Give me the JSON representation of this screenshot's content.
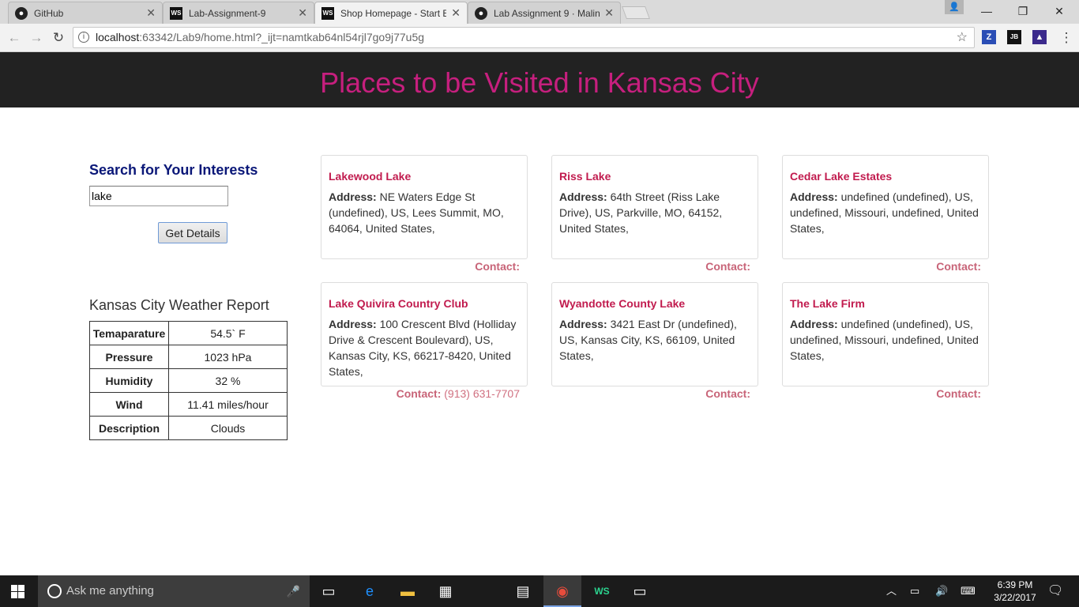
{
  "browser": {
    "tabs": [
      {
        "label": "GitHub",
        "icon": "github-icon"
      },
      {
        "label": "Lab-Assignment-9",
        "icon": "webstorm-icon"
      },
      {
        "label": "Shop Homepage - Start B",
        "icon": "webstorm-icon"
      },
      {
        "label": "Lab Assignment 9 · Malin",
        "icon": "github-icon"
      }
    ],
    "address_host": "localhost",
    "address_rest": ":63342/Lab9/home.html?_ijt=namtkab64nl54rjl7go9j77u5g"
  },
  "page": {
    "title": "Places to be Visited in Kansas City",
    "search": {
      "heading": "Search for Your Interests",
      "value": "lake",
      "button": "Get Details"
    },
    "weather": {
      "heading": "Kansas City Weather Report",
      "rows": [
        {
          "key": "Temaparature",
          "value": "54.5` F"
        },
        {
          "key": "Pressure",
          "value": "1023 hPa"
        },
        {
          "key": "Humidity",
          "value": "32 %"
        },
        {
          "key": "Wind",
          "value": "11.41 miles/hour"
        },
        {
          "key": "Description",
          "value": "Clouds"
        }
      ]
    },
    "address_label": "Address:",
    "contact_label": "Contact:",
    "places": [
      {
        "name": "Lakewood Lake",
        "address": "NE Waters Edge St (undefined), US, Lees Summit, MO, 64064, United States,",
        "contact": ""
      },
      {
        "name": "Riss Lake",
        "address": "64th Street (Riss Lake Drive), US, Parkville, MO, 64152, United States,",
        "contact": ""
      },
      {
        "name": "Cedar Lake Estates",
        "address": "undefined (undefined), US, undefined, Missouri, undefined, United States,",
        "contact": ""
      },
      {
        "name": "Lake Quivira Country Club",
        "address": "100 Crescent Blvd (Holliday Drive & Crescent Boulevard), US, Kansas City, KS, 66217-8420, United States,",
        "contact": "(913) 631-7707"
      },
      {
        "name": "Wyandotte County Lake",
        "address": "3421 East Dr (undefined), US, Kansas City, KS, 66109, United States,",
        "contact": ""
      },
      {
        "name": "The Lake Firm",
        "address": "undefined (undefined), US, undefined, Missouri, undefined, United States,",
        "contact": ""
      }
    ]
  },
  "taskbar": {
    "search_placeholder": "Ask me anything",
    "time": "6:39 PM",
    "date": "3/22/2017"
  },
  "colors": {
    "title": "#c61f7e",
    "header_bg": "#222222",
    "place_name": "#c11b4e",
    "search_heading": "#0a1778"
  }
}
